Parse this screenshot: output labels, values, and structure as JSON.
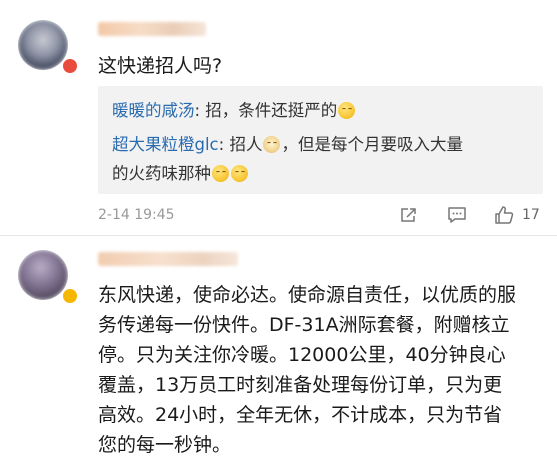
{
  "comment1": {
    "text": "这快递招人吗?",
    "replies": [
      {
        "name": "暖暖的咸汤",
        "content": ": 招，条件还挺严的",
        "emojis": [
          "smile-emoji"
        ]
      },
      {
        "name": "超大果粒橙glc",
        "content_a": ": 招人",
        "content_b": "，但是每个月要吸入大量",
        "content_c": "的火药味那种",
        "emojis": [
          "doge-emoji",
          "smile-emoji",
          "smile-emoji"
        ]
      }
    ],
    "timestamp": "2-14 19:45",
    "actions": [
      "share-icon",
      "comment-icon",
      "like-icon"
    ],
    "like_count": "17"
  },
  "comment2": {
    "lines": [
      "东风快递，使命必达。使命源自责任，以优质的服",
      "务传递每一份快件。DF-31A洲际套餐，附赠核立",
      "停。只为关注你冷暖。12000公里，40分钟良心",
      "覆盖，13万员工时刻准备处理每份订单，只为更",
      "高效。24小时，全年无休，不计成本，只为节省",
      "您的每一秒钟。"
    ],
    "verified_badge": "verified-badge-icon"
  },
  "colors": {
    "reply_name": "#2b6cb0",
    "reply_bg": "#f2f2f2",
    "timestamp": "#999999",
    "verified_badge": "#f5b700",
    "red_badge": "#e94b3c"
  }
}
